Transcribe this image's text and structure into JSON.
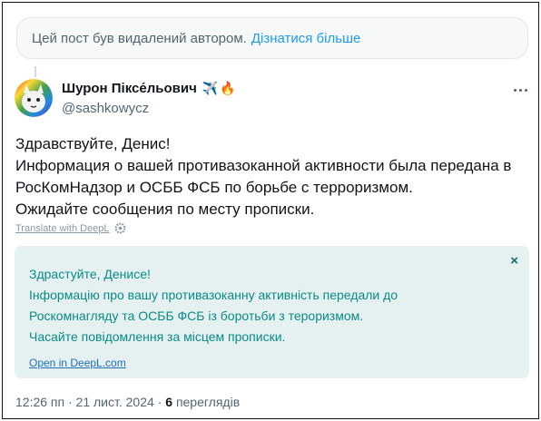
{
  "deleted_notice": {
    "text": "Цей пост був видалений автором.",
    "link": "Дізнатися більше"
  },
  "author": {
    "display_name": "Шурон Піксе́льович",
    "emoji": [
      "✈️",
      "🔥"
    ],
    "handle": "@sashkowycz"
  },
  "tweet": {
    "lines": [
      "Здравствуйте, Денис!",
      "Информация о вашей противазоканной активности была передана в",
      "РосКомНадзор и ОСББ ФСБ по борьбе с терроризмом.",
      "Ожидайте сообщения по месту прописки."
    ]
  },
  "translate": {
    "label": "Translate with DeepL"
  },
  "deepl": {
    "close": "×",
    "lines": [
      "Здрастуйте, Денисе!",
      "Інформацію про вашу противазоканну активність передали до",
      "Роскомнагляду та ОСББ ФСБ із боротьби з тероризмом.",
      "Часайте повідомлення за місцем прописки."
    ],
    "link": "Open in DeepL.com"
  },
  "meta": {
    "time": "12:26 пп",
    "separator": "·",
    "date": "21 лист. 2024",
    "views_count": "6",
    "views_label": "переглядів"
  },
  "colors": {
    "accent": "#1d9bf0",
    "deepl_bg": "#e4f1f0",
    "deepl_text": "#0b8a86"
  }
}
